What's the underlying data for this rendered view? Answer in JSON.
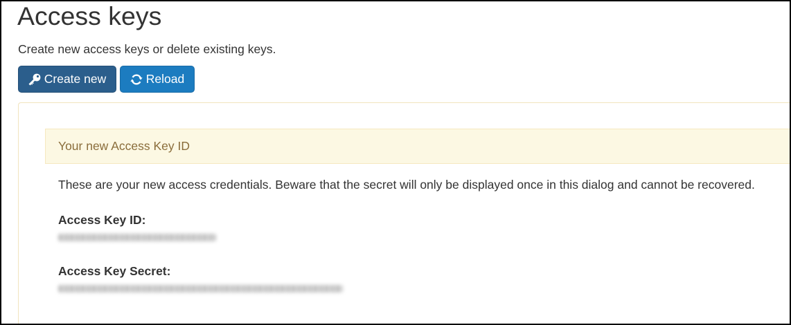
{
  "page": {
    "title": "Access keys",
    "subtitle": "Create new access keys or delete existing keys."
  },
  "toolbar": {
    "create_button": {
      "label": "Create new",
      "icon": "key-icon"
    },
    "reload_button": {
      "label": "Reload",
      "icon": "refresh-icon"
    }
  },
  "new_key_panel": {
    "heading": "Your new Access Key ID",
    "message": "These are your new access credentials. Beware that the secret will only be displayed once in this dialog and cannot be recovered.",
    "fields": [
      {
        "label": "Access Key ID:"
      },
      {
        "label": "Access Key Secret:"
      }
    ]
  },
  "colors": {
    "create_button": "#2b5e8c",
    "reload_button": "#1c7cc0",
    "panel_heading_background": "#fcf8e3",
    "panel_heading_text": "#8a6d3b",
    "panel_border": "#f1e4bd",
    "text": "#333333"
  }
}
